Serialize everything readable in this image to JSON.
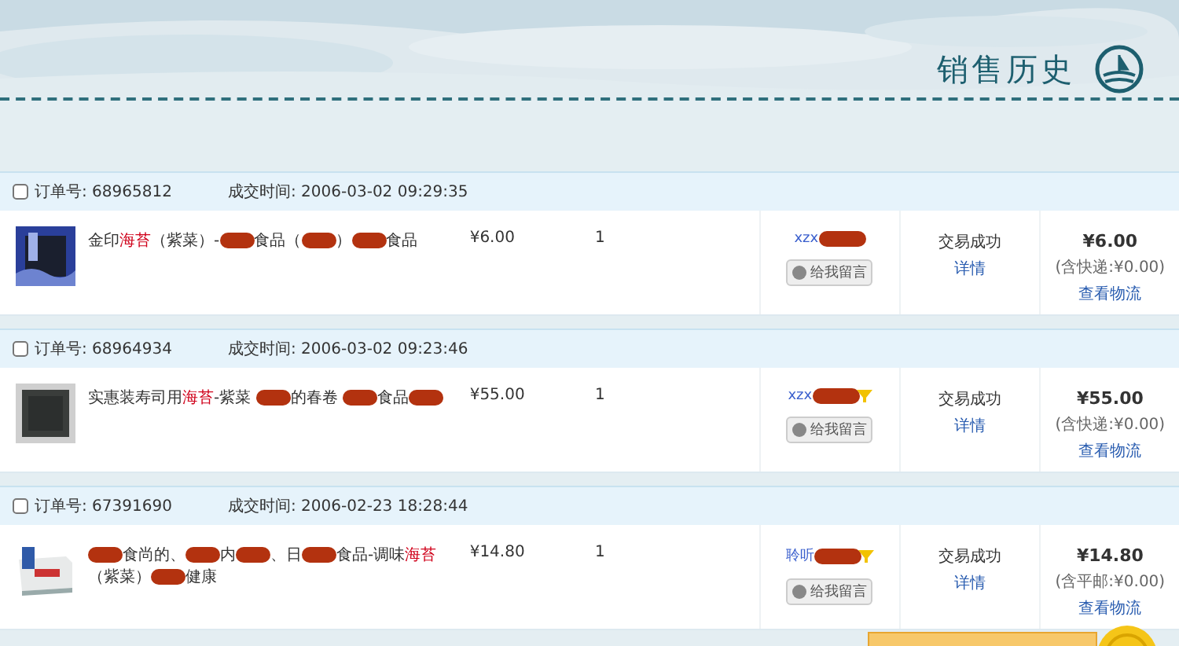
{
  "header": {
    "title": "销售历史"
  },
  "orders": [
    {
      "order_label": "订单号:",
      "order_no": "68965812",
      "time_label": "成交时间:",
      "time": "2006-03-02 09:29:35",
      "checked": false,
      "title": [
        {
          "kind": "text",
          "text": "金印"
        },
        {
          "kind": "hl",
          "text": "海苔"
        },
        {
          "kind": "text",
          "text": "（紫菜）-"
        },
        {
          "kind": "redacted"
        },
        {
          "kind": "text",
          "text": "食品（"
        },
        {
          "kind": "redacted"
        },
        {
          "kind": "text",
          "text": "）"
        },
        {
          "kind": "redacted"
        },
        {
          "kind": "text",
          "text": "食品"
        }
      ],
      "price": "¥6.00",
      "qty": "1",
      "seller": "xzx",
      "seller_badge": false,
      "message_button": "给我留言",
      "status": "交易成功",
      "details_link": "详情",
      "total": "¥6.00",
      "shipping": "(含快递:¥0.00)",
      "logistics_link": "查看物流"
    },
    {
      "order_label": "订单号:",
      "order_no": "68964934",
      "time_label": "成交时间:",
      "time": "2006-03-02 09:23:46",
      "checked": false,
      "title": [
        {
          "kind": "text",
          "text": "实惠装寿司用"
        },
        {
          "kind": "hl",
          "text": "海苔"
        },
        {
          "kind": "text",
          "text": "-紫菜 "
        },
        {
          "kind": "redacted"
        },
        {
          "kind": "text",
          "text": "的春卷 "
        },
        {
          "kind": "redacted"
        },
        {
          "kind": "text",
          "text": "食品"
        },
        {
          "kind": "redacted"
        }
      ],
      "price": "¥55.00",
      "qty": "1",
      "seller": "xzx",
      "seller_badge": true,
      "message_button": "给我留言",
      "status": "交易成功",
      "details_link": "详情",
      "total": "¥55.00",
      "shipping": "(含快递:¥0.00)",
      "logistics_link": "查看物流"
    },
    {
      "order_label": "订单号:",
      "order_no": "67391690",
      "time_label": "成交时间:",
      "time": "2006-02-23 18:28:44",
      "checked": false,
      "title": [
        {
          "kind": "redacted"
        },
        {
          "kind": "text",
          "text": "食尚的、"
        },
        {
          "kind": "redacted"
        },
        {
          "kind": "text",
          "text": "内"
        },
        {
          "kind": "redacted"
        },
        {
          "kind": "text",
          "text": "、日"
        },
        {
          "kind": "redacted"
        },
        {
          "kind": "text",
          "text": "食品-调味"
        },
        {
          "kind": "hl",
          "text": "海苔"
        },
        {
          "kind": "text",
          "text": "（紫菜）"
        },
        {
          "kind": "redacted"
        },
        {
          "kind": "text",
          "text": "健康"
        }
      ],
      "price": "¥14.80",
      "qty": "1",
      "seller": "聆听",
      "seller_badge": true,
      "message_button": "给我留言",
      "status": "交易成功",
      "details_link": "详情",
      "total": "¥14.80",
      "shipping": "(含平邮:¥0.00)",
      "logistics_link": "查看物流"
    }
  ]
}
